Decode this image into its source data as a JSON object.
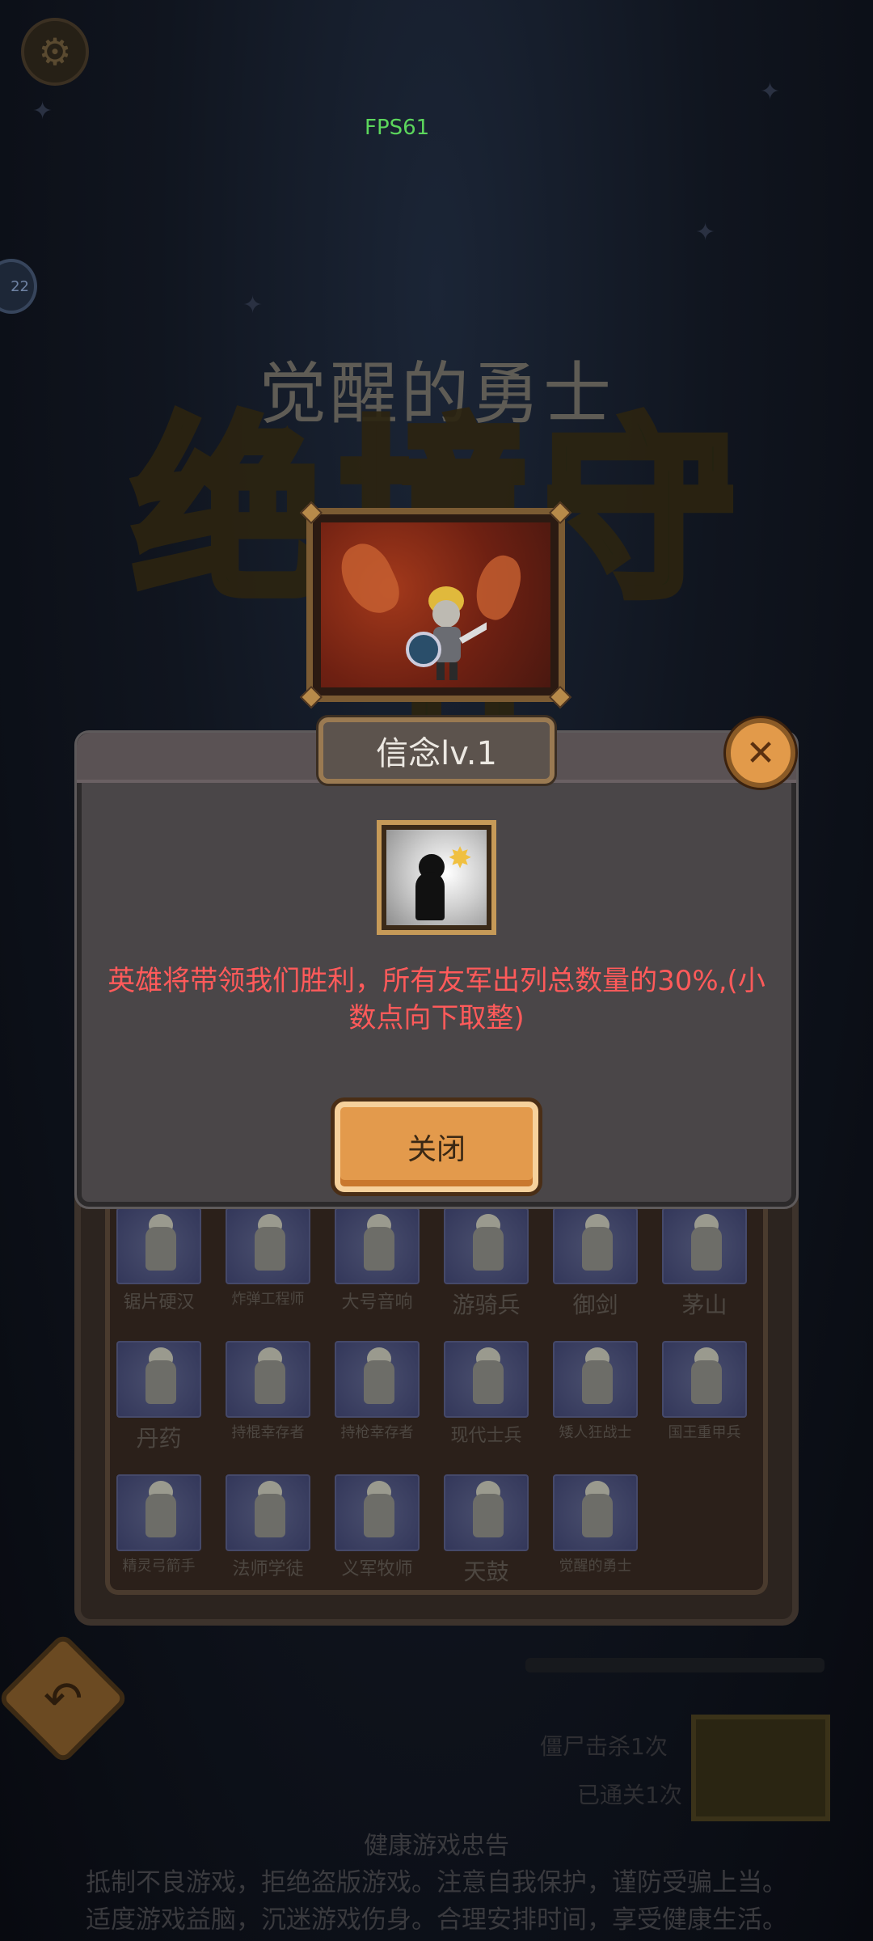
{
  "hud": {
    "fps_text": "FPS61",
    "side_badge": "22"
  },
  "hero": {
    "name": "觉醒的勇士",
    "logo_text": "绝境守卫"
  },
  "dialog": {
    "title": "信念lv.1",
    "description": "英雄将带领我们胜利，所有友军出列总数量的30%,(小数点向下取整)",
    "close_button_label": "关闭",
    "close_icon": "close-icon",
    "skill_icon": "belief-skill-icon"
  },
  "roster": {
    "units": [
      {
        "name": "锯片硬汉"
      },
      {
        "name": "炸弹工程师"
      },
      {
        "name": "大号音响"
      },
      {
        "name": "游骑兵"
      },
      {
        "name": "御剑"
      },
      {
        "name": "茅山"
      },
      {
        "name": "丹药"
      },
      {
        "name": "持棍幸存者"
      },
      {
        "name": "持枪幸存者"
      },
      {
        "name": "现代士兵"
      },
      {
        "name": "矮人狂战士"
      },
      {
        "name": "国王重甲兵"
      },
      {
        "name": "精灵弓箭手"
      },
      {
        "name": "法师学徒"
      },
      {
        "name": "义军牧师"
      },
      {
        "name": "天鼓"
      },
      {
        "name": "觉醒的勇士"
      }
    ]
  },
  "footer": {
    "stat_line_1": "僵尸击杀1次",
    "stat_line_2": "已通关1次",
    "notice_title": "健康游戏忠告",
    "notice_line_1": "抵制不良游戏，拒绝盗版游戏。注意自我保护，谨防受骗上当。",
    "notice_line_2": "适度游戏益脑，沉迷游戏伤身。合理安排时间，享受健康生活。"
  },
  "colors": {
    "dialog_text": "#ff5a5a",
    "fps": "#5cd65c",
    "button": "#e39a4c"
  }
}
